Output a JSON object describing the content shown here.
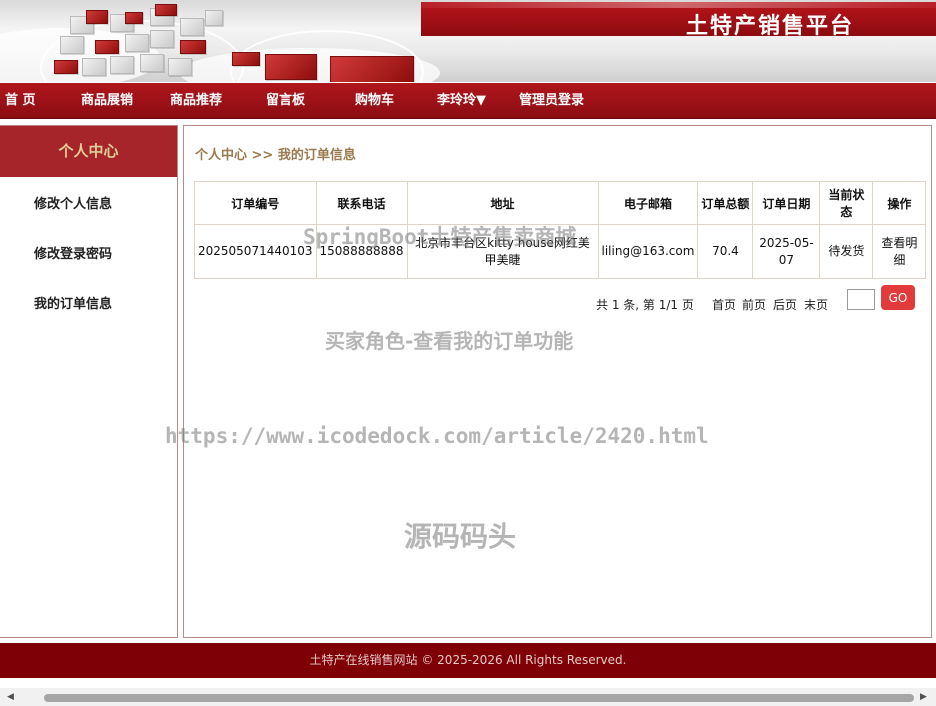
{
  "header": {
    "site_title": "土特产销售平台"
  },
  "nav": {
    "items": [
      "首 页",
      "商品展销",
      "商品推荐",
      "留言板",
      "购物车",
      "李玲玲▼",
      "管理员登录"
    ]
  },
  "sidebar": {
    "title": "个人中心",
    "items": [
      "修改个人信息",
      "修改登录密码",
      "我的订单信息"
    ]
  },
  "main": {
    "breadcrumb": "个人中心 >> 我的订单信息",
    "table": {
      "headers": [
        "订单编号",
        "联系电话",
        "地址",
        "电子邮箱",
        "订单总额",
        "订单日期",
        "当前状态",
        "操作"
      ],
      "rows": [
        [
          "202505071440103",
          "15088888888",
          "北京市丰台区kitty house网红美甲美睫",
          "liling@163.com",
          "70.4",
          "2025-05-07",
          "待发货",
          "查看明细"
        ]
      ]
    },
    "pager": {
      "summary": "共 1 条, 第 1/1 页",
      "first": "首页",
      "prev": "前页",
      "next": "后页",
      "last": "末页",
      "go": "GO"
    }
  },
  "watermarks": {
    "line1": "SpringBoot土特产售卖商城",
    "line2": "买家角色-查看我的订单功能",
    "line3": "https://www.icodedock.com/article/2420.html",
    "line4": "源码码头"
  },
  "footer": {
    "text": "土特产在线销售网站  © 2025-2026 All Rights Reserved."
  },
  "colors": {
    "brand_red": "#8a0d12",
    "go_button": "#e23b3b",
    "sidebar_head": "#a5252a",
    "breadcrumb": "#9a7a4e"
  }
}
